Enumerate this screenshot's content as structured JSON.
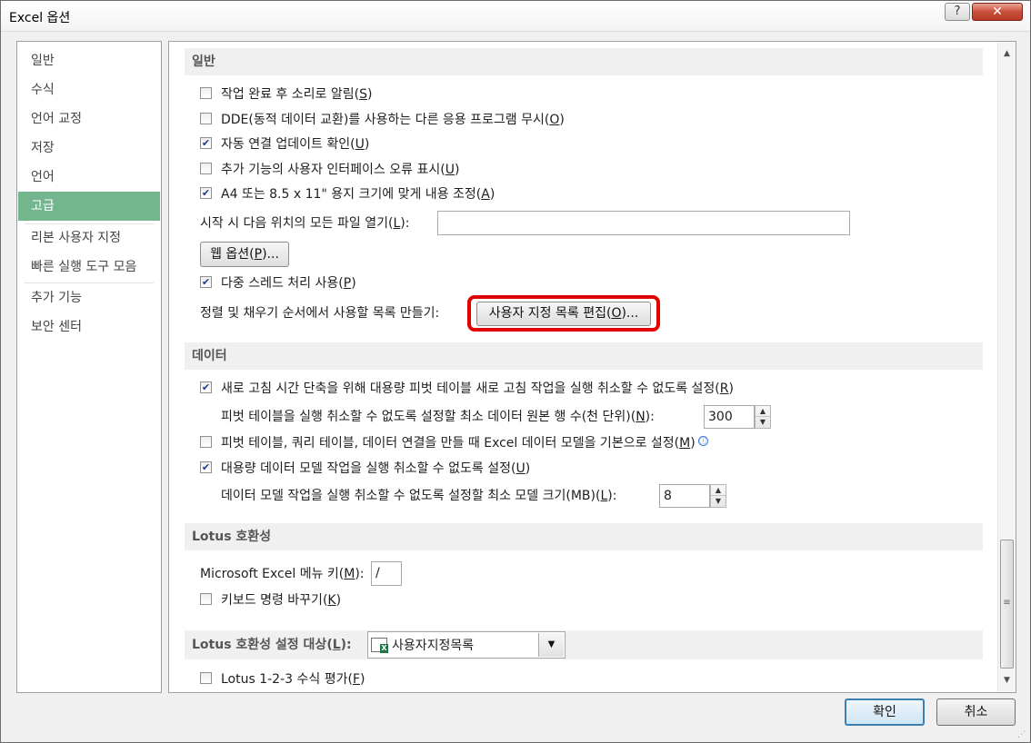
{
  "window": {
    "title": "Excel 옵션",
    "help_label": "?",
    "close_label": "✕"
  },
  "nav": {
    "items": [
      "일반",
      "수식",
      "언어 교정",
      "저장",
      "언어",
      "고급",
      "리본 사용자 지정",
      "빠른 실행 도구 모음",
      "추가 기능",
      "보안 센터"
    ],
    "selected": "고급"
  },
  "sections": {
    "general": {
      "title": "일반",
      "opt_sound": {
        "label": "작업 완료 후 소리로 알림(",
        "key": "S",
        "tail": ")",
        "checked": false
      },
      "opt_dde": {
        "label": "DDE(동적 데이터 교환)를 사용하는 다른 응용 프로그램 무시(",
        "key": "O",
        "tail": ")",
        "checked": false
      },
      "opt_links": {
        "label": "자동 연결 업데이트 확인(",
        "key": "U",
        "tail": ")",
        "checked": true
      },
      "opt_ui_errors": {
        "label": "추가 기능의 사용자 인터페이스 오류 표시(",
        "key": "U",
        "tail": ")",
        "checked": false
      },
      "opt_a4": {
        "label": "A4 또는 8.5 x 11\" 용지 크기에 맞게 내용 조정(",
        "key": "A",
        "tail": ")",
        "checked": true
      },
      "open_files_label": {
        "label": "시작 시 다음 위치의 모든 파일 열기(",
        "key": "L",
        "tail": "):"
      },
      "open_files_value": "",
      "web_options_button": {
        "label": "웹 옵션(",
        "key": "P",
        "tail": ")..."
      },
      "opt_multithread": {
        "label": "다중 스레드 처리 사용(",
        "key": "P",
        "tail": ")",
        "checked": true
      },
      "custom_lists_label": "정렬 및 채우기 순서에서 사용할 목록 만들기:",
      "custom_lists_button": {
        "label": "사용자 지정 목록 편집(",
        "key": "O",
        "tail": ")..."
      }
    },
    "data": {
      "title": "데이터",
      "opt_pivot_undo": {
        "label": "새로 고침 시간 단축을 위해 대용량 피벗 테이블 새로 고침 작업을 실행 취소할 수 없도록 설정(",
        "key": "R",
        "tail": ")",
        "checked": true
      },
      "pivot_rows_label": {
        "label": "피벗 테이블을 실행 취소할 수 없도록 설정할 최소 데이터 원본 행 수(천 단위)(",
        "key": "N",
        "tail": "):"
      },
      "pivot_rows_value": "300",
      "opt_data_model": {
        "label": "피벗 테이블, 쿼리 테이블, 데이터 연결을 만들 때 Excel 데이터 모델을 기본으로 설정(",
        "key": "M",
        "tail": ")",
        "checked": false
      },
      "info_icon": "ⓘ",
      "opt_model_undo": {
        "label": "대용량 데이터 모델 작업을 실행 취소할 수 없도록 설정(",
        "key": "U",
        "tail": ")",
        "checked": true
      },
      "model_size_label": {
        "label": "데이터 모델 작업을 실행 취소할 수 없도록 설정할 최소 모델 크기(MB)(",
        "key": "L",
        "tail": "):"
      },
      "model_size_value": "8"
    },
    "lotus": {
      "title": "Lotus 호환성",
      "menu_key_label": {
        "label": "Microsoft Excel 메뉴 키(",
        "key": "M",
        "tail": "):"
      },
      "menu_key_value": "/",
      "opt_nav_keys": {
        "label": "키보드 명령 바꾸기(",
        "key": "K",
        "tail": ")",
        "checked": false
      }
    },
    "lotus_target": {
      "title": {
        "label": "Lotus 호환성 설정 대상(",
        "key": "L",
        "tail": "):"
      },
      "sheet_value": "사용자지정목록",
      "opt_formula_eval": {
        "label": "Lotus 1-2-3 수식 평가(",
        "key": "F",
        "tail": ")",
        "checked": false
      }
    }
  },
  "footer": {
    "ok_label": "확인",
    "cancel_label": "취소"
  },
  "colors": {
    "nav_selected": "#73b68e",
    "highlight_frame": "#e00000",
    "section_header_bg": "#f0f0f0"
  },
  "icons": {
    "checkbox_checked": "✔",
    "scroll_up": "▲",
    "scroll_down": "▼",
    "dropdown": "▼",
    "sheet_icon": "worksheet-icon"
  }
}
